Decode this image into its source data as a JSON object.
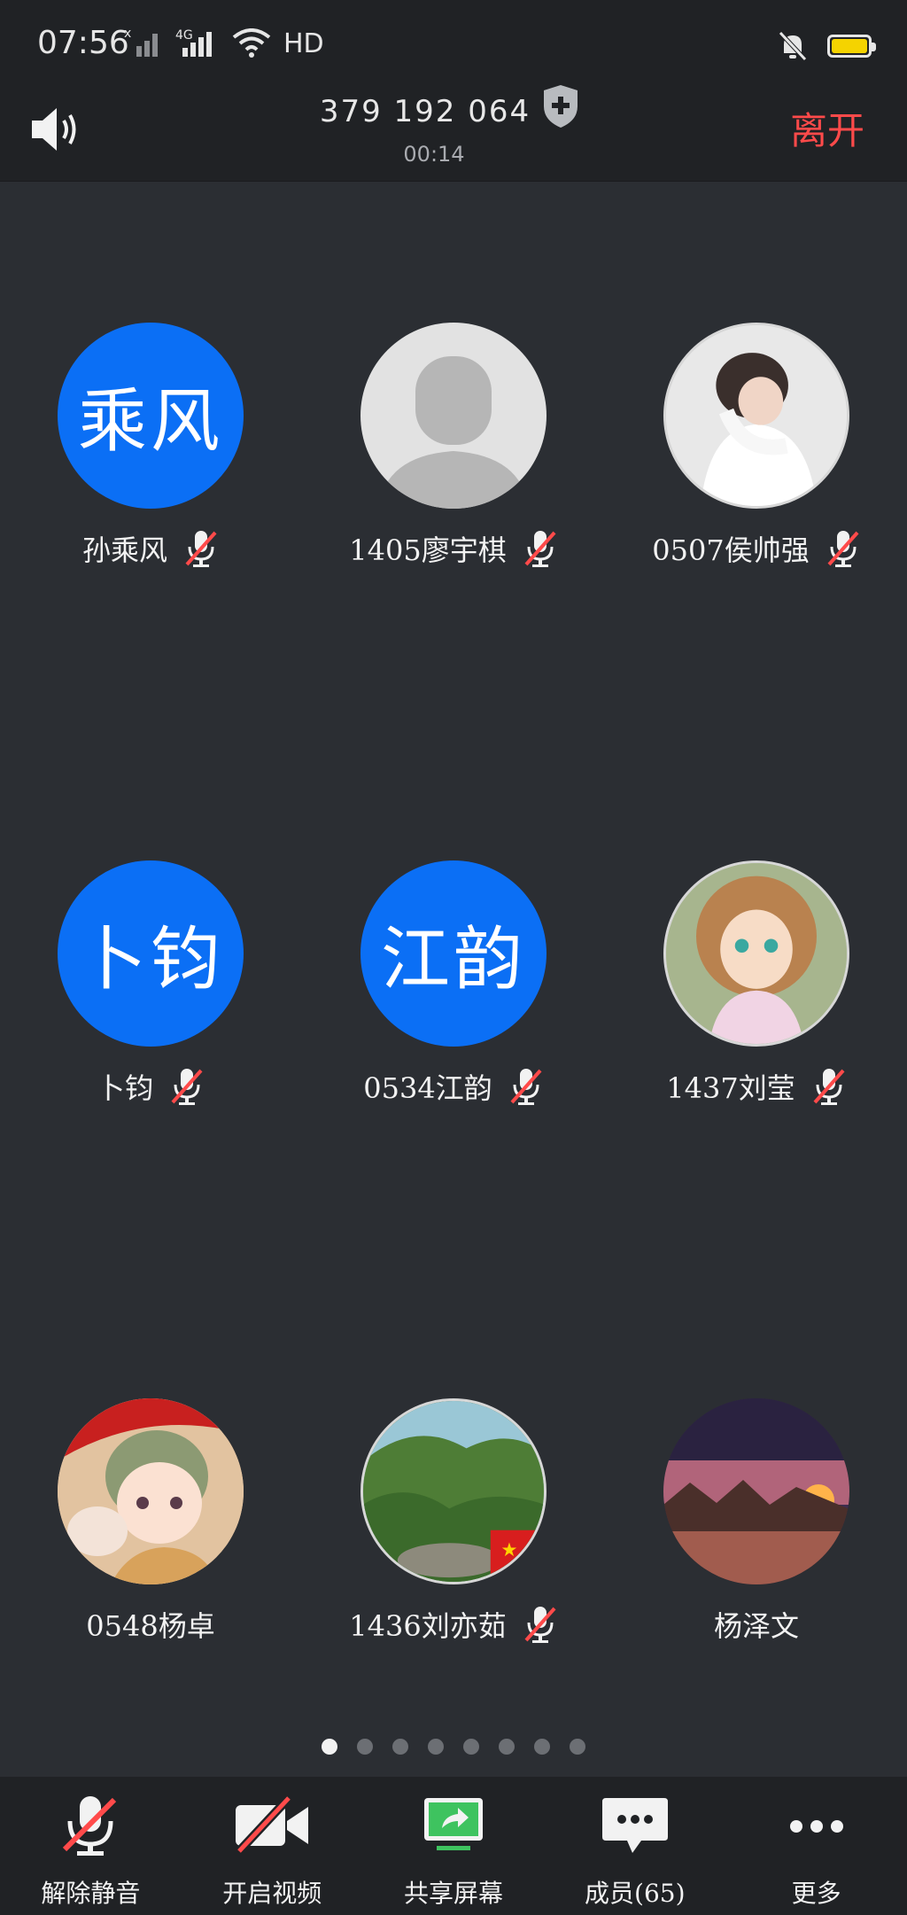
{
  "status_bar": {
    "time": "07:56",
    "network_label": "4G",
    "hd_label": "HD",
    "icons": [
      "signal-x-icon",
      "signal-4g-icon",
      "wifi-icon",
      "hd-icon",
      "mute-bell-icon",
      "battery-icon"
    ],
    "battery_color": "#f5d300"
  },
  "header": {
    "meeting_id": "379 192 064",
    "duration": "00:14",
    "leave_label": "离开",
    "leave_color": "#ff4a4a",
    "speaker_icon": "speaker-icon",
    "shield_icon": "shield-plus-icon"
  },
  "participants": [
    {
      "name": "孙乘风",
      "avatar_type": "initials",
      "initials": "乘风",
      "muted": true
    },
    {
      "name": "1405廖宇棋",
      "avatar_type": "default",
      "muted": true
    },
    {
      "name": "0507侯帅强",
      "avatar_type": "photo",
      "muted": true
    },
    {
      "name": "卜钧",
      "avatar_type": "initials",
      "initials": "卜钧",
      "muted": true
    },
    {
      "name": "0534江韵",
      "avatar_type": "initials",
      "initials": "江韵",
      "muted": true
    },
    {
      "name": "1437刘莹",
      "avatar_type": "photo",
      "muted": true
    },
    {
      "name": "0548杨卓",
      "avatar_type": "photo",
      "muted": false
    },
    {
      "name": "1436刘亦茹",
      "avatar_type": "photo",
      "muted": true
    },
    {
      "name": "杨泽文",
      "avatar_type": "photo",
      "muted": false
    }
  ],
  "pager": {
    "pages": 8,
    "current": 1
  },
  "toolbar": {
    "unmute_label": "解除静音",
    "video_label": "开启视频",
    "share_label": "共享屏幕",
    "members_label": "成员(65)",
    "more_label": "更多",
    "accent_green": "#3ec35f",
    "mute_red": "#ff4a4a"
  }
}
